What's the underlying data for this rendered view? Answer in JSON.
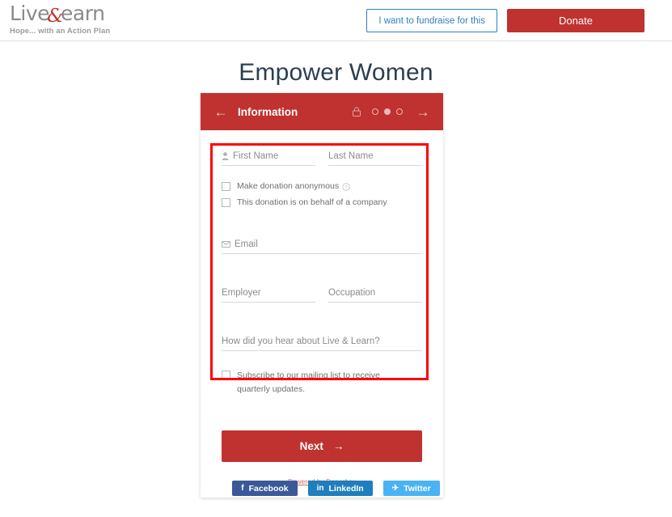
{
  "header": {
    "logo": {
      "text_before": "Live",
      "ampersand": "&",
      "text_after": "earn",
      "tagline": "Hope... with an Action Plan"
    },
    "fundraise_label": "I want to fundraise for this",
    "donate_label": "Donate"
  },
  "page": {
    "title": "Empower Women"
  },
  "card": {
    "step_title": "Information",
    "back_arrow": "←",
    "forward_arrow": "→",
    "steps": [
      {
        "label": "step-1",
        "active": false
      },
      {
        "label": "step-2",
        "active": true
      },
      {
        "label": "step-3",
        "active": false
      }
    ],
    "form": {
      "first_name_placeholder": "First Name",
      "last_name_placeholder": "Last Name",
      "anonymous_label": "Make donation anonymous",
      "company_label": "This donation is on behalf of a company",
      "email_placeholder": "Email",
      "employer_placeholder": "Employer",
      "occupation_placeholder": "Occupation",
      "referral_placeholder": "How did you hear about Live & Learn?",
      "subscribe_label": "Subscribe to our mailing list to receive quarterly updates."
    },
    "next_label": "Next",
    "next_arrow": "→",
    "powered_by": "Powered by Donorbox"
  },
  "social": {
    "facebook": {
      "label": "Facebook",
      "glyph": "f"
    },
    "linkedin": {
      "label": "LinkedIn",
      "glyph": "in"
    },
    "twitter": {
      "label": "Twitter",
      "glyph": "✈"
    }
  },
  "colors": {
    "brand_red": "#c0322f",
    "annotation_red": "#ff0000",
    "title_slate": "#2b3f51",
    "link_blue": "#2f7fc1",
    "facebook_blue": "#3b5998",
    "linkedin_blue": "#1f7ebd",
    "twitter_blue": "#4ab3f4"
  }
}
